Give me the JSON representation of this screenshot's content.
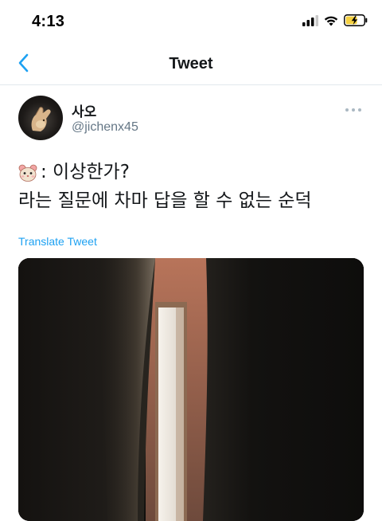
{
  "status_bar": {
    "time": "4:13"
  },
  "nav": {
    "title": "Tweet",
    "back_icon": "chevron-left-icon"
  },
  "tweet": {
    "display_name": "사오",
    "handle": "@jichenx45",
    "line1": ": 이상한가?",
    "line2": "라는 질문에 차마 답을 할 수 없는 순덕",
    "translate_label": "Translate Tweet",
    "emoji_icon": "hamster-face-icon",
    "more_icon": "more-horizontal-icon"
  },
  "colors": {
    "accent": "#1da1f2",
    "secondary_text": "#657786",
    "battery_fill": "#f5d142"
  }
}
